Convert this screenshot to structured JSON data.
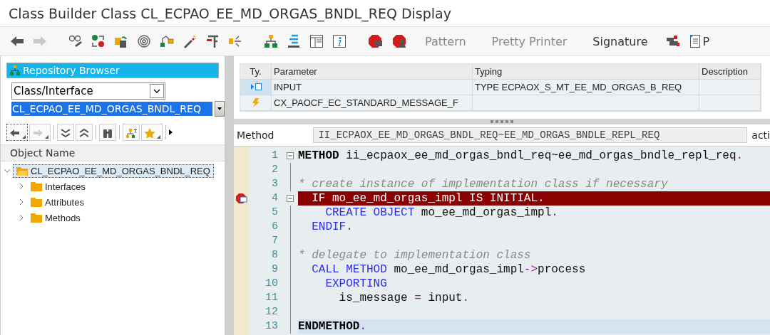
{
  "window": {
    "title": "Class Builder Class CL_ECPAO_EE_MD_ORGAS_BNDL_REQ Display"
  },
  "toolbar": {
    "nav": [
      {
        "kind": "back",
        "disabled": false
      },
      {
        "kind": "forward",
        "disabled": true
      }
    ],
    "buttons": [
      {
        "label": "Pattern",
        "disabled": true
      },
      {
        "label": "Pretty Printer",
        "disabled": true
      },
      {
        "label": "Signature",
        "disabled": false
      }
    ],
    "trailing_label": "P"
  },
  "repository_browser": {
    "title": "Repository Browser",
    "object_type": "Class/Interface",
    "object_name": "CL_ECPAO_EE_MD_ORGAS_BNDL_REQ",
    "tree_header": "Object Name",
    "tree": [
      {
        "label": "CL_ECPAO_EE_MD_ORGAS_BNDL_REQ",
        "expanded": true,
        "selected": true,
        "children": [
          {
            "label": "Interfaces",
            "expanded": false,
            "selected": false
          },
          {
            "label": "Attributes",
            "expanded": false,
            "selected": false
          },
          {
            "label": "Methods",
            "expanded": false,
            "selected": false
          }
        ]
      }
    ]
  },
  "parameters": {
    "columns": [
      "Ty.",
      "Parameter",
      "Typing",
      "Description"
    ],
    "rows": [
      {
        "kind": "importing",
        "selected": true,
        "parameter": "INPUT",
        "typing": "TYPE ECPAOX_S_MT_EE_MD_ORGAS_B_REQ"
      },
      {
        "kind": "exception",
        "selected": false,
        "parameter": "CX_PAOCF_EC_STANDARD_MESSAGE_F"
      }
    ]
  },
  "method_row": {
    "label": "Method",
    "value": "II_ECPAOX_EE_MD_ORGAS_BNDL_REQ~EE_MD_ORGAS_BNDLE_REPL_REQ",
    "trailing": "acti"
  },
  "editor": {
    "lines": [
      {
        "number": "1",
        "fold_toggle": true,
        "breakpoint": false,
        "current": false,
        "tokens": [
          {
            "kind": "keyword-bold",
            "text": "METHOD"
          },
          {
            "kind": "plain",
            "text": " ii_ecpaox_ee_md_orgas_bndl_req~ee_md_orgas_bndle_repl_req"
          },
          {
            "kind": "punct",
            "text": "."
          }
        ]
      },
      {
        "number": "2",
        "fold_toggle": false,
        "breakpoint": false,
        "current": false
      },
      {
        "number": "3",
        "fold_toggle": false,
        "breakpoint": false,
        "current": false,
        "tokens": [
          {
            "kind": "comment",
            "text": "* create instance of implementation class if necessary"
          }
        ]
      },
      {
        "number": "4",
        "fold_toggle": true,
        "breakpoint": true,
        "current": false,
        "tokens": [
          {
            "kind": "keyword",
            "text": "  IF"
          },
          {
            "kind": "plain",
            "text": " mo_ee_md_orgas_impl "
          },
          {
            "kind": "keyword",
            "text": "IS INITIAL"
          },
          {
            "kind": "punct",
            "text": "."
          }
        ]
      },
      {
        "number": "5",
        "fold_toggle": false,
        "breakpoint": false,
        "current": false,
        "tokens": [
          {
            "kind": "keyword",
            "text": "    CREATE OBJECT"
          },
          {
            "kind": "plain",
            "text": " mo_ee_md_orgas_impl"
          },
          {
            "kind": "punct",
            "text": "."
          }
        ]
      },
      {
        "number": "6",
        "fold_toggle": false,
        "breakpoint": false,
        "current": false,
        "tokens": [
          {
            "kind": "keyword",
            "text": "  ENDIF"
          },
          {
            "kind": "punct",
            "text": "."
          }
        ]
      },
      {
        "number": "7",
        "fold_toggle": false,
        "breakpoint": false,
        "current": false
      },
      {
        "number": "8",
        "fold_toggle": false,
        "breakpoint": false,
        "current": false,
        "tokens": [
          {
            "kind": "comment",
            "text": "* delegate to implementation class"
          }
        ]
      },
      {
        "number": "9",
        "fold_toggle": false,
        "breakpoint": false,
        "current": false,
        "tokens": [
          {
            "kind": "keyword",
            "text": "  CALL METHOD"
          },
          {
            "kind": "plain",
            "text": " mo_ee_md_orgas_impl"
          },
          {
            "kind": "punct",
            "text": "->"
          },
          {
            "kind": "plain",
            "text": "process"
          }
        ]
      },
      {
        "number": "10",
        "fold_toggle": false,
        "breakpoint": false,
        "current": false,
        "tokens": [
          {
            "kind": "keyword",
            "text": "    EXPORTING"
          }
        ]
      },
      {
        "number": "11",
        "fold_toggle": false,
        "breakpoint": false,
        "current": false,
        "tokens": [
          {
            "kind": "plain",
            "text": "      is_message "
          },
          {
            "kind": "punct",
            "text": "="
          },
          {
            "kind": "plain",
            "text": " input"
          },
          {
            "kind": "punct",
            "text": "."
          }
        ]
      },
      {
        "number": "12",
        "fold_toggle": false,
        "breakpoint": false,
        "current": false
      },
      {
        "number": "13",
        "fold_toggle": false,
        "breakpoint": false,
        "current": true,
        "tokens": [
          {
            "kind": "keyword-bold",
            "text": "ENDMETHOD"
          },
          {
            "kind": "punct",
            "text": "."
          }
        ]
      }
    ]
  }
}
